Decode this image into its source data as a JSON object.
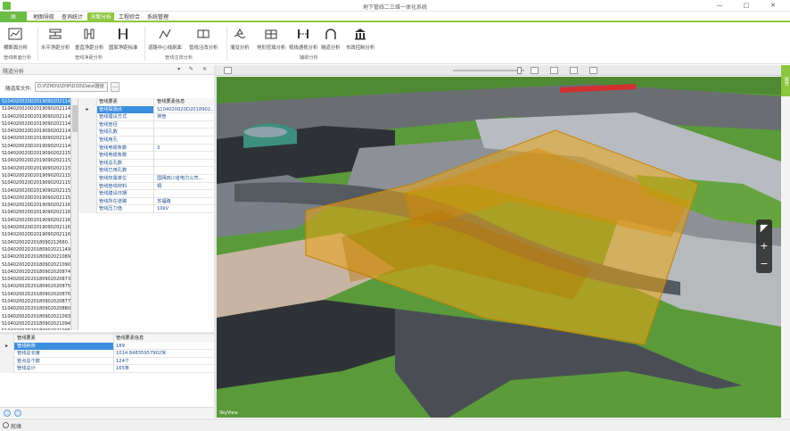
{
  "window": {
    "title": "地下管线二三维一体化系统",
    "controls": [
      "—",
      "□",
      "✕"
    ]
  },
  "menu": {
    "tabs": [
      "地图导航",
      "查询统计",
      "决策分析",
      "工程综合",
      "系统管理"
    ],
    "active_index": 2
  },
  "ribbon": {
    "buttons": [
      {
        "label": "横断面分析",
        "icon": "cross-section-chart-icon"
      },
      {
        "label": "水平净距分析",
        "icon": "horizontal-distance-icon"
      },
      {
        "label": "垂直净距分析",
        "icon": "vertical-distance-icon"
      },
      {
        "label": "国家净距标准",
        "icon": "standard-distance-icon"
      },
      {
        "label": "道路中心线剖面",
        "icon": "road-centerline-icon"
      },
      {
        "label": "管线注改分析",
        "icon": "pipeline-change-icon"
      },
      {
        "label": "淹没分析",
        "icon": "flood-analysis-icon"
      },
      {
        "label": "地形挖填分析",
        "icon": "cut-fill-analysis-icon"
      },
      {
        "label": "视线通视分析",
        "icon": "line-of-sight-icon"
      },
      {
        "label": "隧道分析",
        "icon": "tunnel-analysis-icon"
      },
      {
        "label": "市政控制分析",
        "icon": "municipal-control-icon"
      }
    ],
    "groups": [
      "管线断面分析",
      "管线净距分析",
      "管线注改分析",
      "辅助分析"
    ]
  },
  "panel": {
    "title": "隧道分析",
    "file_label": "隧道库文件:",
    "file_value": "D:\\FZHD\\DZHP\\D3D\\Data\\隧道",
    "browse_label": "..."
  },
  "id_list": [
    "S104020020D20190902021148...",
    "S104020020D20190902021143...",
    "S104020020D20190902021148...",
    "S104020020D20190902021144...",
    "S104020020D20190902021144...",
    "S104020020D20190902021146...",
    "S104020020D20190902021148...",
    "S104020020D20190902021151...",
    "S104020020D20190902021152...",
    "S104020020D20190902021153...",
    "S104020020D20190902021155...",
    "S104020020D20190902021156...",
    "S104020020D20190902021158...",
    "S104020020D20190902021159...",
    "S104020020D20190902021161...",
    "S104020020D20190902021162...",
    "S104020020D20190902021164...",
    "S104020020D20190902021165...",
    "S104020020D20190902021166...",
    "S10402002D2018090212660...",
    "S10402002D20180902021149...",
    "S10402002D20180902021089...",
    "S10402002D20180902021090...",
    "S10402002D20180902020874...",
    "S10402002D20180902020873...",
    "S10402002D20180902020875...",
    "S10402002D20180902020876...",
    "S10402002D20180902020877...",
    "S10402002D20180902020880...",
    "S10402002D20180902021093...",
    "S10402002D20180902021094...",
    "S10402002D20180902021095..."
  ],
  "attr_table": {
    "headers": [
      "管线要素",
      "管线要素信息"
    ],
    "rows": [
      {
        "key": "管线探测点",
        "value": "S104020020D2018902..."
      },
      {
        "key": "管线埋设方式",
        "value": "排管"
      },
      {
        "key": "管线管径",
        "value": ""
      },
      {
        "key": "管线孔数",
        "value": ""
      },
      {
        "key": "管线用孔",
        "value": ""
      },
      {
        "key": "管线电缆条数",
        "value": "3"
      },
      {
        "key": "管线电缆条数",
        "value": ""
      },
      {
        "key": "管线总孔数",
        "value": ""
      },
      {
        "key": "管线已用孔数",
        "value": ""
      },
      {
        "key": "管线权属单位",
        "value": "国网四川省电力公司..."
      },
      {
        "key": "管线管线材料",
        "value": "铜"
      },
      {
        "key": "管线建设日期",
        "value": ""
      },
      {
        "key": "管线所在道路",
        "value": "苏福路"
      },
      {
        "key": "管线压力值",
        "value": "10kV"
      }
    ]
  },
  "summary_table": {
    "headers": [
      "管线要素",
      "管线要素信息"
    ],
    "rows": [
      {
        "key": "管线种类",
        "value": "189"
      },
      {
        "key": "管线总长度",
        "value": "1014.84835957902米"
      },
      {
        "key": "管点总个数",
        "value": "124个"
      },
      {
        "key": "管线总计",
        "value": "165条"
      }
    ]
  },
  "scene": {
    "label": "SkyView"
  },
  "right_tab": "属性",
  "status": "就绪"
}
